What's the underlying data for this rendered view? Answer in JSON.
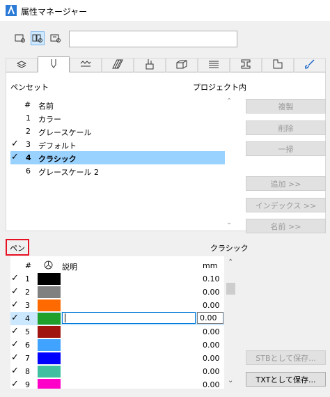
{
  "window": {
    "title": "属性マネージャー"
  },
  "search": {
    "value": ""
  },
  "penset_section": {
    "label": "ペンセット",
    "location": "プロジェクト内"
  },
  "penset_list": {
    "headers": {
      "num": "#",
      "name": "名前"
    },
    "rows": [
      {
        "check": "",
        "num": "1",
        "name": "カラー"
      },
      {
        "check": "",
        "num": "2",
        "name": "グレースケール"
      },
      {
        "check": "✓",
        "num": "3",
        "name": "デフォルト"
      },
      {
        "check": "✓",
        "num": "4",
        "name": "クラシック",
        "selected": true
      },
      {
        "check": "",
        "num": "6",
        "name": "グレースケール 2"
      }
    ]
  },
  "buttons": {
    "duplicate": "複製",
    "delete": "削除",
    "purge": "一掃",
    "add": "追加 >>",
    "index": "インデックス >>",
    "name": "名前 >>",
    "save_stb": "STBとして保存...",
    "save_txt": "TXTとして保存..."
  },
  "pen_section": {
    "label": "ペン",
    "current_set": "クラシック"
  },
  "pen_table": {
    "headers": {
      "num": "#",
      "desc": "説明",
      "mm": "mm"
    },
    "rows": [
      {
        "check": "✓",
        "num": "1",
        "color": "#000000",
        "mm": "0.10"
      },
      {
        "check": "✓",
        "num": "2",
        "color": "#808080",
        "mm": "0.00"
      },
      {
        "check": "✓",
        "num": "3",
        "color": "#ff6a00",
        "mm": "0.00"
      },
      {
        "check": "✓",
        "num": "4",
        "color": "#1fa02b",
        "mm": "0.00",
        "selected": true
      },
      {
        "check": "✓",
        "num": "5",
        "color": "#a0150f",
        "mm": "0.00"
      },
      {
        "check": "✓",
        "num": "6",
        "color": "#3fa3ff",
        "mm": "0.00"
      },
      {
        "check": "✓",
        "num": "7",
        "color": "#0000ff",
        "mm": "0.00"
      },
      {
        "check": "✓",
        "num": "8",
        "color": "#40c0a0",
        "mm": "0.00"
      },
      {
        "check": "✓",
        "num": "9",
        "color": "#ff00c8",
        "mm": "0.00"
      }
    ]
  },
  "icons": {
    "tabs": [
      "layers-icon",
      "pen-icon",
      "line-type-icon",
      "fill-icon",
      "paint-icon",
      "building-material-icon",
      "surface-icon",
      "profile-icon",
      "zone-icon",
      "brush-icon"
    ]
  }
}
